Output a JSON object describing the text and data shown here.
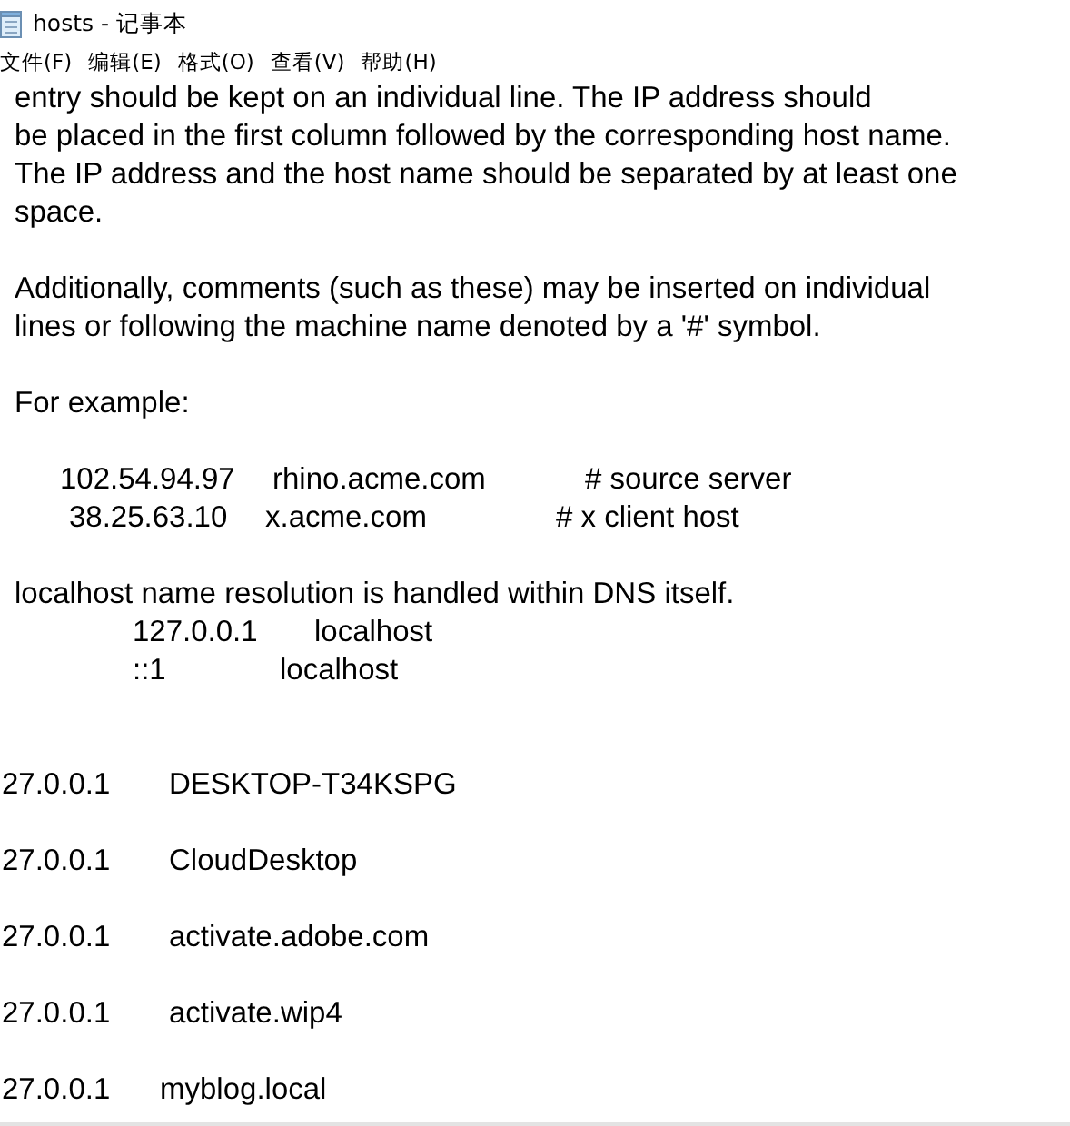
{
  "window": {
    "title": "hosts - 记事本"
  },
  "menu": [
    {
      "label": "文件(F)"
    },
    {
      "label": "编辑(E)"
    },
    {
      "label": "格式(O)"
    },
    {
      "label": "查看(V)"
    },
    {
      "label": "帮助(H)"
    }
  ],
  "lines": [
    {
      "kind": "text",
      "text": "entry should be kept on an individual line. The IP address should"
    },
    {
      "kind": "text",
      "text": "be placed in the first column followed by the corresponding host name."
    },
    {
      "kind": "text",
      "text": "The IP address and the host name should be separated by at least one"
    },
    {
      "kind": "text",
      "text": "space."
    },
    {
      "kind": "blank"
    },
    {
      "kind": "text",
      "text": "Additionally, comments (such as these) may be inserted on individual"
    },
    {
      "kind": "text",
      "text": "lines or following the machine name denoted by a '#' symbol."
    },
    {
      "kind": "blank"
    },
    {
      "kind": "text",
      "text": "For example:"
    },
    {
      "kind": "blank"
    },
    {
      "kind": "entry",
      "fields": [
        "102.54.94.97",
        "rhino.acme.com",
        "# source server"
      ]
    },
    {
      "kind": "entry",
      "fields": [
        "38.25.63.10",
        "x.acme.com",
        "# x client host"
      ]
    },
    {
      "kind": "blank"
    },
    {
      "kind": "text",
      "text": "localhost name resolution is handled within DNS itself."
    },
    {
      "kind": "entry",
      "fields": [
        "127.0.0.1",
        "localhost"
      ]
    },
    {
      "kind": "entry",
      "fields": [
        "::1",
        "localhost"
      ]
    },
    {
      "kind": "blank"
    },
    {
      "kind": "blank"
    },
    {
      "kind": "entry",
      "fields": [
        "27.0.0.1",
        "DESKTOP-T34KSPG"
      ]
    },
    {
      "kind": "blank"
    },
    {
      "kind": "entry",
      "fields": [
        "27.0.0.1",
        "CloudDesktop"
      ]
    },
    {
      "kind": "blank"
    },
    {
      "kind": "entry",
      "fields": [
        "27.0.0.1",
        "activate.adobe.com"
      ]
    },
    {
      "kind": "blank"
    },
    {
      "kind": "entry",
      "fields": [
        "27.0.0.1",
        "activate.wip4"
      ]
    },
    {
      "kind": "blank"
    },
    {
      "kind": "entry",
      "fields": [
        "27.0.0.1",
        "myblog.local"
      ]
    }
  ]
}
